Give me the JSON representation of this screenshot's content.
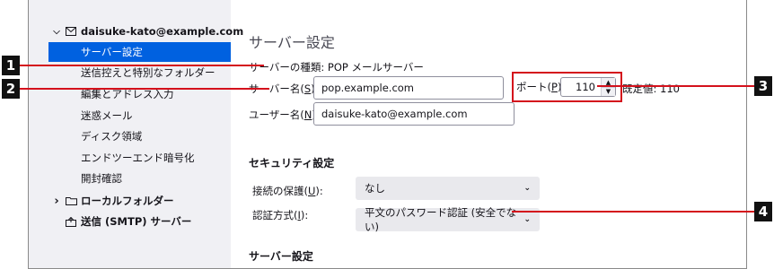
{
  "sidebar": {
    "account": {
      "label": "daisuke-kato@example.com",
      "expand_glyph": "⌵",
      "icon": "mail-icon"
    },
    "items": [
      {
        "label": "サーバー設定",
        "selected": true
      },
      {
        "label": "送信控えと特別なフォルダー"
      },
      {
        "label": "編集とアドレス入力"
      },
      {
        "label": "迷惑メール"
      },
      {
        "label": "ディスク領域"
      },
      {
        "label": "エンドツーエンド暗号化"
      },
      {
        "label": "開封確認"
      }
    ],
    "local_folders": {
      "label": "ローカルフォルダー",
      "expand_glyph": "›",
      "icon": "folder-icon"
    },
    "smtp": {
      "label": "送信 (SMTP) サーバー",
      "icon": "outbox-icon"
    }
  },
  "main": {
    "title": "サーバー設定",
    "server_type": {
      "label": "サーバーの種類: POP メールサーバー"
    },
    "server_name": {
      "label_pre": "サーバー名(",
      "mnemonic": "S",
      "label_post": "):",
      "value": "pop.example.com"
    },
    "port": {
      "label_pre": "ポート(",
      "mnemonic": "P",
      "label_post": "):",
      "value": "110",
      "default_text": "既定値: 110"
    },
    "user_name": {
      "label_pre": "ユーザー名(",
      "mnemonic": "N",
      "label_post": "):",
      "value": "daisuke-kato@example.com"
    },
    "security_heading": "セキュリティ設定",
    "connection_security": {
      "label_pre": "接続の保護(",
      "mnemonic": "U",
      "label_post": "):",
      "value": "なし"
    },
    "auth_method": {
      "label_pre": "認証方式(",
      "mnemonic": "I",
      "label_post": "):",
      "value": "平文のパスワード認証 (安全でない)"
    },
    "server_settings_heading": "サーバー設定"
  },
  "callouts": [
    "1",
    "2",
    "3",
    "4"
  ],
  "colors": {
    "accent": "#0061e0",
    "callout": "#d4111c",
    "sidebar_bg": "#f0f0f4"
  }
}
